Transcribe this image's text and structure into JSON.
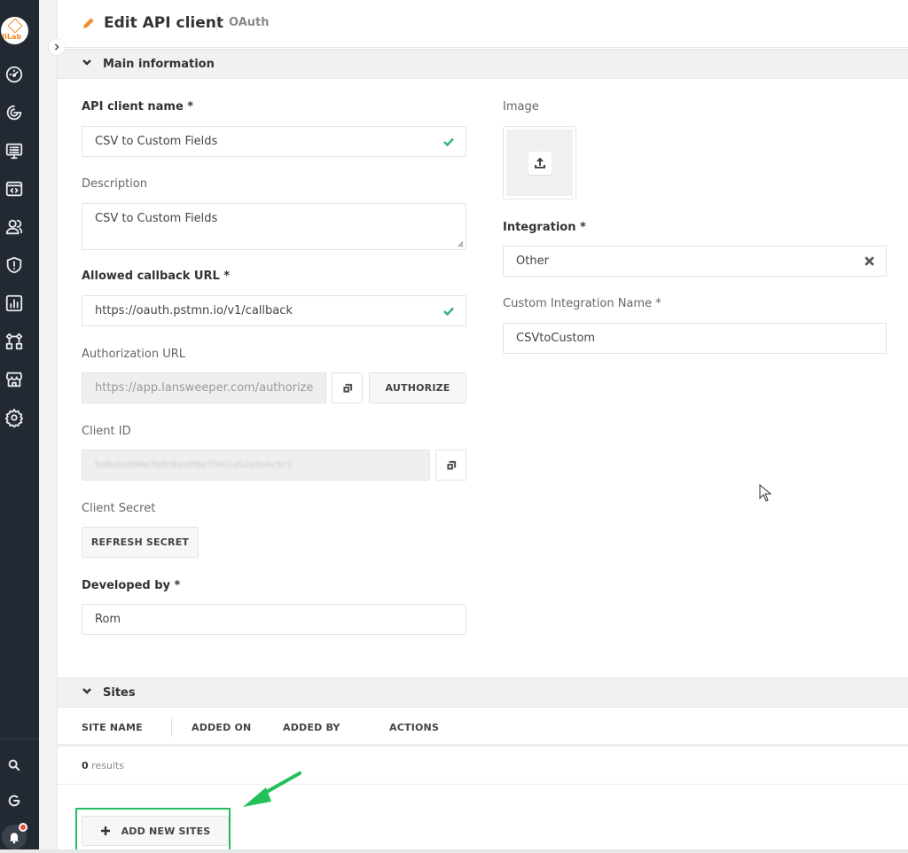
{
  "sidebar": {
    "logo_text": "IILab",
    "nav": [
      {
        "name": "dashboard"
      },
      {
        "name": "discovery"
      },
      {
        "name": "inventory"
      },
      {
        "name": "scripts"
      },
      {
        "name": "users"
      },
      {
        "name": "security"
      },
      {
        "name": "reports"
      },
      {
        "name": "integrations"
      },
      {
        "name": "marketplace"
      },
      {
        "name": "settings"
      }
    ],
    "bottom": [
      {
        "name": "search"
      },
      {
        "name": "refresh"
      },
      {
        "name": "notifications"
      }
    ]
  },
  "header": {
    "title": "Edit API client",
    "subtitle": "OAuth"
  },
  "main_information": {
    "section_label": "Main information",
    "api_client_name": {
      "label": "API client name *",
      "value": "CSV to Custom Fields",
      "valid": true
    },
    "description": {
      "label": "Description",
      "value": "CSV to Custom Fields"
    },
    "allowed_callback_url": {
      "label": "Allowed callback URL *",
      "value": "https://oauth.pstmn.io/v1/callback",
      "valid": true
    },
    "authorization_url": {
      "label": "Authorization URL",
      "value": "https://app.lansweeper.com/authorize",
      "authorize_label": "AUTHORIZE"
    },
    "client_id": {
      "label": "Client ID",
      "value": "5a6c0c0d4e7b0c9ac0f8e7f4e1ab2e3a4c5c1"
    },
    "client_secret": {
      "label": "Client Secret",
      "refresh_label": "REFRESH SECRET"
    },
    "developed_by": {
      "label": "Developed by *",
      "value": "Rom"
    },
    "image": {
      "label": "Image"
    },
    "integration": {
      "label": "Integration *",
      "value": "Other"
    },
    "custom_integration_name": {
      "label": "Custom Integration Name *",
      "value": "CSVtoCustom"
    }
  },
  "sites": {
    "section_label": "Sites",
    "columns": [
      "SITE NAME",
      "ADDED ON",
      "ADDED BY",
      "ACTIONS"
    ],
    "rows": [],
    "results_count": "0",
    "results_label": " results",
    "add_label": "ADD NEW SITES"
  },
  "colors": {
    "sidebar_bg": "#222933",
    "accent_orange": "#f08a24",
    "valid_green": "#2bb673",
    "annotation_green": "#22c05a"
  }
}
